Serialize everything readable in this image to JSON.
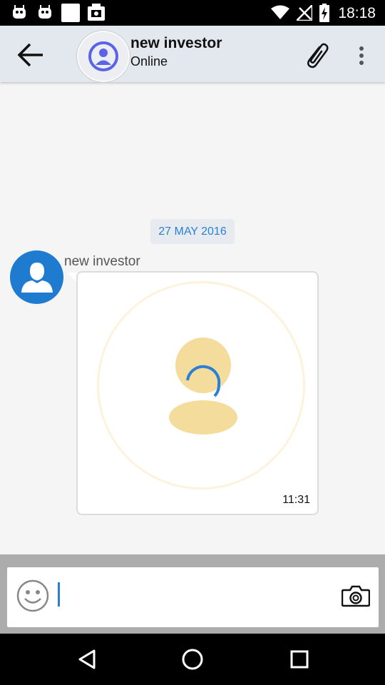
{
  "status_bar": {
    "time": "18:18",
    "icons": [
      "android-notification-icon",
      "android-notification-icon",
      "blank-notification-icon",
      "photo-notification-icon",
      "wifi-icon",
      "no-signal-icon",
      "battery-charging-icon"
    ]
  },
  "toolbar": {
    "contact_name": "new investor",
    "contact_status": "Online",
    "icons": {
      "back": "arrow-back-icon",
      "attach": "paperclip-icon",
      "menu": "more-vert-icon"
    }
  },
  "chat": {
    "date": "27 MAY 2016",
    "message": {
      "sender": "new investor",
      "time": "11:31",
      "content_type": "image-loading"
    }
  },
  "composer": {
    "value": "",
    "icons": {
      "emoji": "smiley-icon",
      "camera": "camera-icon"
    }
  },
  "nav": {
    "icons": [
      "back-triangle-icon",
      "home-circle-icon",
      "recents-square-icon"
    ]
  },
  "colors": {
    "accent": "#2a7fd6",
    "toolbar_bg": "#e3e8ee",
    "avatar_bg": "#1f7bcf",
    "placeholder_fill": "#f4dd9c"
  }
}
